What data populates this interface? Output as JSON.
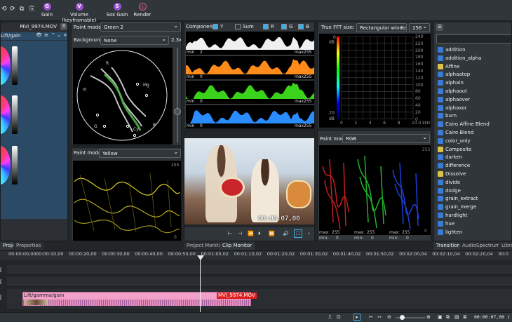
{
  "toolbar": {
    "items": [
      {
        "label": "Gain",
        "badge": "G"
      },
      {
        "label": "Volume (keyframable)",
        "badge": "V"
      },
      {
        "label": "Sox Gain",
        "badge": "S"
      },
      {
        "label": "Render",
        "badge": ""
      }
    ]
  },
  "left_panel": {
    "clip_title": "MVI_9974.MOV",
    "effect_name": "Lift/gain",
    "tabs": [
      "Project Bin",
      "Properties"
    ]
  },
  "vectorscope": {
    "paint_mode_label": "Paint mode",
    "paint_mode_value": "Green 2",
    "background_label": "Background",
    "background_value": "None",
    "zoom": "2,3x",
    "targets": [
      "Mg",
      "R",
      "Yl",
      "B",
      "G",
      "Cy"
    ]
  },
  "waveform": {
    "paint_mode_label": "Paint mode",
    "paint_mode_value": "Yellow",
    "max_label": "255",
    "min_label": "0"
  },
  "histogram": {
    "components_label": "Components",
    "checks": [
      {
        "label": "Y",
        "checked": true
      },
      {
        "label": "Sum",
        "checked": false
      },
      {
        "label": "R",
        "checked": true
      },
      {
        "label": "G",
        "checked": true
      },
      {
        "label": "B",
        "checked": true
      }
    ],
    "rows": [
      {
        "min": "2",
        "max": "255",
        "color": "#f0f0f0"
      },
      {
        "min": "0",
        "max": "255",
        "color": "#ff8c1a"
      },
      {
        "min": "0",
        "max": "255",
        "color": "#3bd21b"
      },
      {
        "min": "0",
        "max": "255",
        "color": "#2a8cff"
      }
    ],
    "min_word": "min",
    "max_word": "max"
  },
  "fft": {
    "title": "True FFT size:",
    "window_value": "Rectangular window",
    "size_value": "256",
    "db_top": "0",
    "db_unit": "dB",
    "db_bottom": "-70",
    "db_bottom_unit": "dB",
    "right_ticks": [
      "240",
      "220",
      "200",
      "180",
      "160",
      "140",
      "120",
      "100",
      "80",
      "60",
      "40",
      "20",
      "0"
    ],
    "x_ticks": [
      "0",
      "2",
      "4",
      "6",
      "8",
      "10.0 kHz"
    ]
  },
  "rgb_parade": {
    "paint_mode_label": "Paint mode",
    "paint_mode_value": "RGB",
    "max_value": "255",
    "min_value": "0",
    "max_word": "max:",
    "min_word": "min:",
    "top_label": "255",
    "bottom_label": "0"
  },
  "monitor": {
    "timecode": "00:00:07,00",
    "tabs": [
      "Project Monitor",
      "Clip Monitor"
    ]
  },
  "effects_list": {
    "items": [
      "addition",
      "addition_alpha",
      "Affine",
      "alphaatop",
      "alphain",
      "alphaout",
      "alphaover",
      "alphaxor",
      "burn",
      "Cairo Affine Blend",
      "Cairo Blend",
      "color_only",
      "Composite",
      "darken",
      "difference",
      "Dissolve",
      "divide",
      "dodge",
      "grain_extract",
      "grain_merge",
      "hardlight",
      "hue",
      "lighten"
    ],
    "tabs": [
      "Transitions",
      "AudioSpectrum",
      "Libra"
    ]
  },
  "timeline": {
    "ruler_start": "00:00:00,00",
    "ticks": [
      "00:00:10,00",
      "00:00:20,00",
      "00:00:30,00",
      "00:00:40,00",
      "00:00:50,00",
      "00:01:00,02",
      "00:01:10,02",
      "00:01:20,02",
      "00:01:30,02",
      "00:01:40,02",
      "00:01:50,02",
      "00:02:00,04",
      "00:02:10,04",
      "00:02:20,04",
      "00:0"
    ],
    "clip_effect": "Lift/gamma/gain",
    "clip_name": "MVI_9974.MOV",
    "status_timecode": "00:00:07,00",
    "status_slash": "/"
  },
  "colors": {
    "accent": "#3daee9",
    "clip_pink": "#f2a0c8",
    "clip_red": "#e02020",
    "badge_purple": "#9b4fd0"
  }
}
